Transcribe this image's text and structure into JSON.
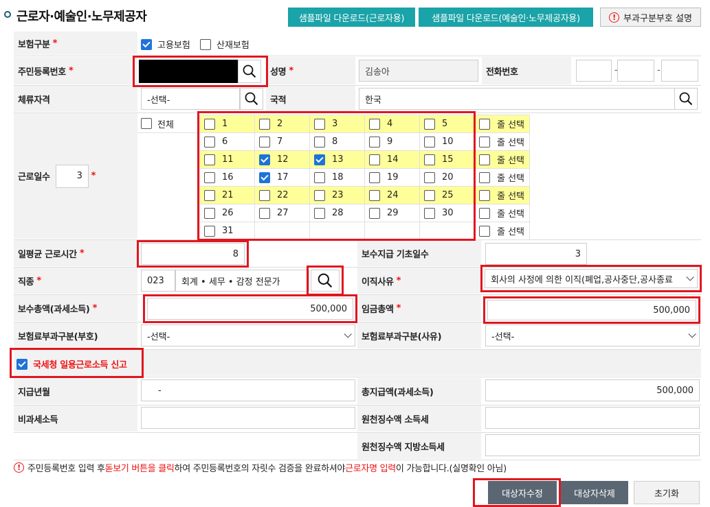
{
  "page": {
    "title": "근로자·예술인·노무제공자"
  },
  "header_buttons": {
    "sample_worker": "샘플파일 다운로드(근로자용)",
    "sample_artist": "샘플파일 다운로드(예술인·노무제공자용)",
    "help": "부과구분부호 설명"
  },
  "form": {
    "insurance_type_label": "보험구분",
    "insurance_options": [
      {
        "label": "고용보험",
        "checked": true
      },
      {
        "label": "산재보험",
        "checked": false
      }
    ],
    "rrn_label": "주민등록번호",
    "name_label": "성명",
    "name_value": "김송아",
    "phone_label": "전화번호",
    "phone_sep": "-",
    "residence_label": "체류자격",
    "residence_value": "-선택-",
    "nationality_label": "국적",
    "nationality_value": "한국",
    "workdays_label": "근로일수",
    "workdays_value": "3",
    "all_label": "전체",
    "row_select_label": "줄 선택",
    "days": [
      [
        "1",
        "2",
        "3",
        "4",
        "5"
      ],
      [
        "6",
        "7",
        "8",
        "9",
        "10"
      ],
      [
        "11",
        "12",
        "13",
        "14",
        "15"
      ],
      [
        "16",
        "17",
        "18",
        "19",
        "20"
      ],
      [
        "21",
        "22",
        "23",
        "24",
        "25"
      ],
      [
        "26",
        "27",
        "28",
        "29",
        "30"
      ],
      [
        "31"
      ]
    ],
    "checked_days": [
      "12",
      "13",
      "17"
    ],
    "avg_hours_label": "일평균 근로시간",
    "avg_hours_value": "8",
    "base_days_label": "보수지급 기초일수",
    "base_days_value": "3",
    "job_label": "직종",
    "job_code": "023",
    "job_name": "회계 • 세무 • 감정 전문가",
    "leave_reason_label": "이직사유",
    "leave_reason_value": "회사의 사정에 의한 이직(폐업,공사중단,공사종료",
    "total_pay_label": "보수총액(과세소득)",
    "total_pay_value": "500,000",
    "total_wage_label": "임금총액",
    "total_wage_value": "500,000",
    "premium_code_label": "보험료부과구분(부호)",
    "premium_code_value": "-선택-",
    "premium_reason_label": "보험료부과구분(사유)",
    "premium_reason_value": "-선택-",
    "nts_report_label": "국세청 일용근로소득 신고",
    "pay_month_label": "지급년월",
    "pay_month_value": "-",
    "total_payment_label": "총지급액(과세소득)",
    "total_payment_value": "500,000",
    "nontax_label": "비과세소득",
    "income_tax_label": "원천징수액 소득세",
    "local_tax_label": "원천징수액 지방소득세"
  },
  "notice": {
    "part1": "주민등록번호 입력 후 ",
    "part2": "돋보기 버튼을 클릭",
    "part3": "하여 주민등록번호의 자릿수 검증을 완료하셔야 ",
    "part4": "근로자명 입력",
    "part5": "이 가능합니다.(실명확인 아님)"
  },
  "actions": {
    "modify": "대상자수정",
    "delete": "대상자삭제",
    "reset": "초기화"
  }
}
